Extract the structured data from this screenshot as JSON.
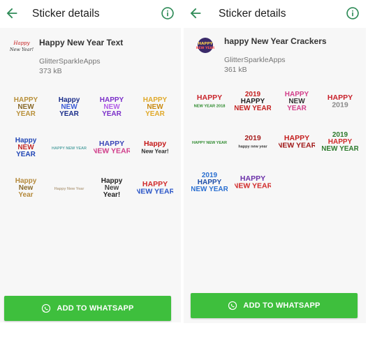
{
  "colors": {
    "accent": "#2e8b57",
    "button": "#3ebf3d",
    "button_text": "#ffffff"
  },
  "left": {
    "title": "Sticker details",
    "pack_name": "Happy New Year Text",
    "publisher": "GlitterSparkleApps",
    "size": "373 kB",
    "button_label": "ADD TO WHATSAPP",
    "stickers": [
      {
        "name": "sticker-happy-new-year-gold",
        "lines": [
          "HAPPY",
          "NEW",
          "YEAR"
        ],
        "colors": [
          "#b8903a",
          "#8a6a2a"
        ]
      },
      {
        "name": "sticker-happy-new-year-blue-sparkle",
        "lines": [
          "Happy",
          "NEW",
          "YEAR"
        ],
        "colors": [
          "#1a2d8a",
          "#3b5bd6"
        ]
      },
      {
        "name": "sticker-happy-new-year-purple",
        "lines": [
          "HAPPY",
          "NEW",
          "YEAR"
        ],
        "colors": [
          "#7b2fc9",
          "#b35ee8"
        ]
      },
      {
        "name": "sticker-happy-new-year-gold-bold",
        "lines": [
          "HAPPY",
          "NEW",
          "YEAR"
        ],
        "colors": [
          "#e0a92a",
          "#c98a12"
        ]
      },
      {
        "name": "sticker-happy-new-year-diagonal",
        "lines": [
          "Happy",
          "NEW",
          "YEAR"
        ],
        "colors": [
          "#2045b5",
          "#c22a2a"
        ]
      },
      {
        "name": "sticker-happy-new-year-ornament",
        "lines": [
          "HAPPY NEW YEAR"
        ],
        "colors": [
          "#5aa6a6",
          "#3a7f86"
        ]
      },
      {
        "name": "sticker-happy-new-year-fireworks",
        "lines": [
          "HAPPY",
          "NEW YEAR"
        ],
        "colors": [
          "#3a46b8",
          "#d03d8a"
        ]
      },
      {
        "name": "sticker-happy-new-year-red-script",
        "lines": [
          "Happy",
          "New Year!"
        ],
        "colors": [
          "#c41818",
          "#2b2b2b"
        ]
      },
      {
        "name": "sticker-happy-new-year-script-gold",
        "lines": [
          "Happy",
          "New",
          "Year"
        ],
        "colors": [
          "#b58a3c",
          "#8a6a2a"
        ]
      },
      {
        "name": "sticker-happy-new-year-thin-script",
        "lines": [
          "Happy New Year"
        ],
        "colors": [
          "#b8a58a",
          "#9c8a70"
        ]
      },
      {
        "name": "sticker-happy-new-year-handwritten",
        "lines": [
          "Happy",
          "New",
          "Year!"
        ],
        "colors": [
          "#222222",
          "#444444"
        ]
      },
      {
        "name": "sticker-happy-new-year-multicolor",
        "lines": [
          "HAPPY",
          "NEW YEAR"
        ],
        "colors": [
          "#d12a2a",
          "#2a55c7"
        ]
      }
    ]
  },
  "right": {
    "title": "Sticker details",
    "pack_name": "happy New Year Crackers",
    "publisher": "GlitterSparkleApps",
    "size": "361 kB",
    "button_label": "ADD TO WHATSAPP",
    "stickers": [
      {
        "name": "sticker-happy-new-year-2018-banner",
        "lines": [
          "HAPPY",
          "NEW YEAR 2018"
        ],
        "colors": [
          "#c9242b",
          "#2c8a2c"
        ]
      },
      {
        "name": "sticker-2019-happy-new-year-red",
        "lines": [
          "2019",
          "HAPPY",
          "NEW YEAR"
        ],
        "colors": [
          "#c41e1e",
          "#1f1f1f"
        ]
      },
      {
        "name": "sticker-happy-new-year-balloons",
        "lines": [
          "HAPPY",
          "NEW",
          "YEAR"
        ],
        "colors": [
          "#d23f8a",
          "#333333"
        ]
      },
      {
        "name": "sticker-happy-new-year-2019-ribbon",
        "lines": [
          "HAPPY",
          "2019"
        ],
        "colors": [
          "#c8202a",
          "#8a8a8a"
        ]
      },
      {
        "name": "sticker-happy-new-year-2020-clock",
        "lines": [
          "HAPPY NEW YEAR"
        ],
        "colors": [
          "#2f8a2f",
          "#d4a020"
        ]
      },
      {
        "name": "sticker-happy-new-year-2019-balloons-black",
        "lines": [
          "2019",
          "happy new year"
        ],
        "colors": [
          "#a82020",
          "#333333"
        ]
      },
      {
        "name": "sticker-happy-new-year-red-italic",
        "lines": [
          "HAPPY",
          "NEW YEAR"
        ],
        "colors": [
          "#c41e1e",
          "#a01818"
        ]
      },
      {
        "name": "sticker-2019-happy-new-year-green",
        "lines": [
          "2019",
          "HAPPY",
          "NEW YEAR"
        ],
        "colors": [
          "#2c7a2c",
          "#d12a2a"
        ]
      },
      {
        "name": "sticker-2019-happy-new-year-blue",
        "lines": [
          "2019",
          "HAPPY",
          "NEW YEAR"
        ],
        "colors": [
          "#2a6fd1",
          "#1d4ea8"
        ]
      },
      {
        "name": "sticker-happy-new-year-crackers-circle",
        "lines": [
          "HAPPY",
          "NEW YEAR"
        ],
        "colors": [
          "#6a2fa8",
          "#d12a2a"
        ]
      }
    ]
  }
}
